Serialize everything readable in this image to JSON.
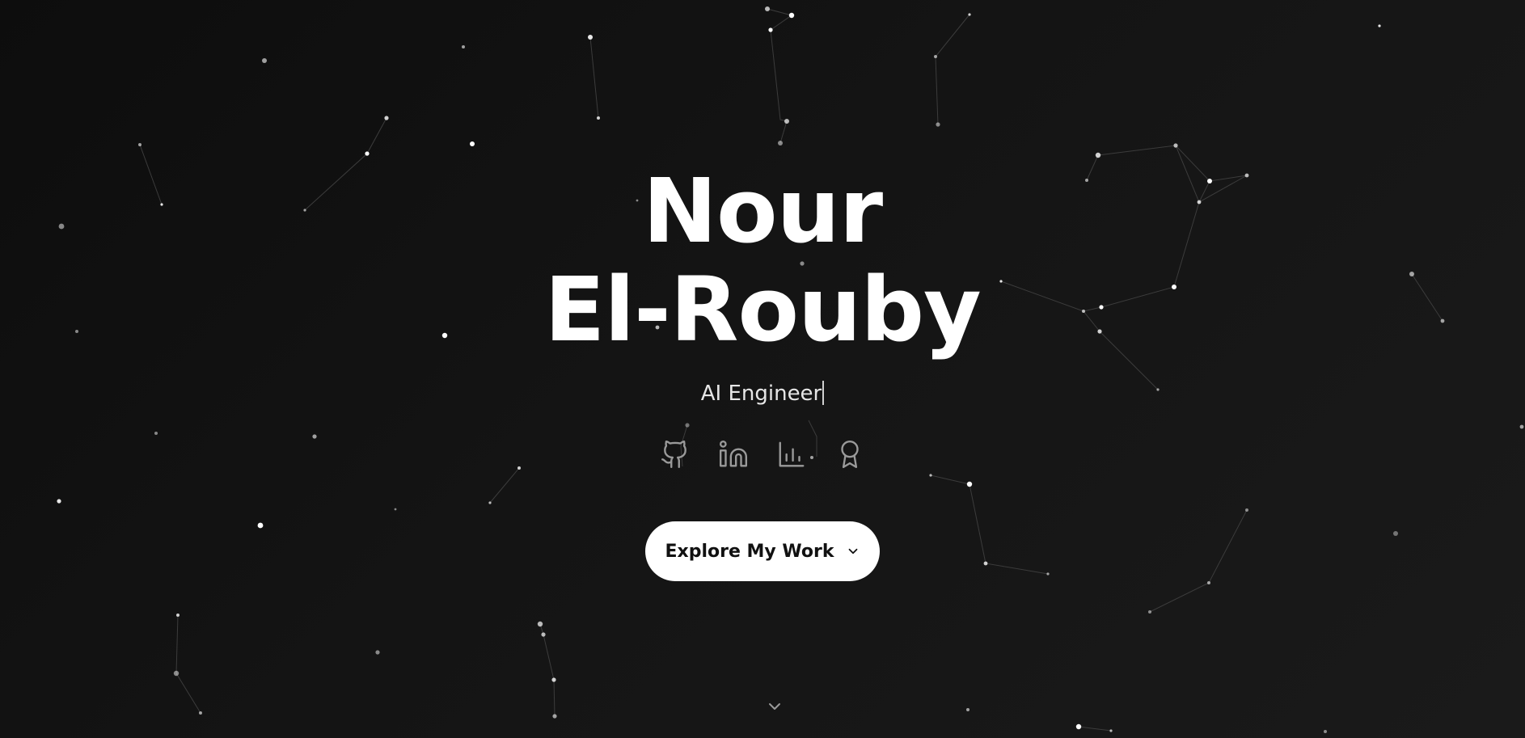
{
  "hero": {
    "name_line1": "Nour",
    "name_line2": "El-Rouby",
    "subtitle": "AI Engineer",
    "cta_label": "Explore My Work"
  },
  "social_links": [
    {
      "icon": "github-icon"
    },
    {
      "icon": "linkedin-icon"
    },
    {
      "icon": "bar-chart-icon"
    },
    {
      "icon": "award-icon"
    }
  ],
  "icons": {
    "cta": "chevron-down-icon",
    "scroll": "chevron-down-icon"
  },
  "colors": {
    "background": "#111111",
    "text": "#ffffff",
    "subtitle": "#e6e6e6",
    "icon": "#9a9a9a",
    "button_bg": "#ffffff",
    "button_text": "#111111",
    "star": "#ffffff",
    "constellation_line": "#3a3a3a"
  }
}
